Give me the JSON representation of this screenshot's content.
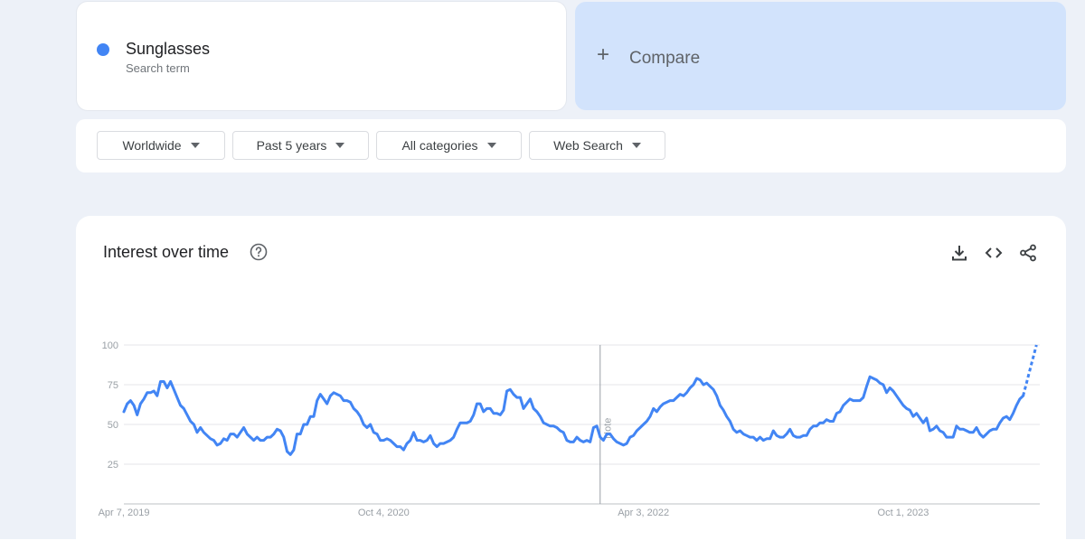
{
  "search_term": {
    "name": "Sunglasses",
    "subtitle": "Search term",
    "color": "#4285f4"
  },
  "compare": {
    "label": "Compare",
    "background": "#d2e3fc"
  },
  "filters": {
    "region": "Worldwide",
    "time_range": "Past 5 years",
    "category": "All categories",
    "search_type": "Web Search"
  },
  "chart": {
    "title": "Interest over time",
    "help_icon": "help-circle-icon",
    "tools": [
      "download-icon",
      "embed-code-icon",
      "share-icon"
    ],
    "note_label": "Note"
  },
  "chart_data": {
    "type": "line",
    "title": "",
    "xlabel": "",
    "ylabel": "",
    "ylim": [
      0,
      100
    ],
    "yticks": [
      25,
      50,
      75,
      100
    ],
    "xtick_labels": [
      "Apr 7, 2019",
      "Oct 4, 2020",
      "Apr 3, 2022",
      "Oct 1, 2023"
    ],
    "grid": true,
    "series": [
      {
        "name": "Sunglasses",
        "color": "#4285f4",
        "values": [
          58,
          63,
          65,
          62,
          56,
          63,
          66,
          70,
          70,
          71,
          68,
          77,
          77,
          73,
          77,
          72,
          67,
          62,
          60,
          56,
          52,
          50,
          45,
          48,
          45,
          43,
          41,
          40,
          37,
          38,
          41,
          40,
          44,
          44,
          42,
          45,
          48,
          44,
          42,
          40,
          42,
          40,
          40,
          42,
          42,
          44,
          47,
          46,
          42,
          33,
          31,
          34,
          44,
          44,
          50,
          50,
          55,
          55,
          65,
          69,
          66,
          63,
          68,
          70,
          69,
          68,
          65,
          65,
          64,
          60,
          58,
          55,
          50,
          48,
          50,
          45,
          44,
          40,
          40,
          41,
          40,
          38,
          36,
          36,
          34,
          38,
          40,
          45,
          40,
          40,
          39,
          40,
          43,
          38,
          36,
          38,
          38,
          39,
          40,
          42,
          47,
          51,
          51,
          51,
          52,
          56,
          63,
          63,
          58,
          60,
          60,
          57,
          57,
          56,
          59,
          71,
          72,
          69,
          67,
          67,
          60,
          63,
          66,
          60,
          58,
          55,
          51,
          50,
          49,
          49,
          48,
          46,
          45,
          40,
          39,
          39,
          42,
          40,
          39,
          40,
          39,
          48,
          49,
          42,
          40,
          44,
          44,
          41,
          39,
          38,
          37,
          38,
          42,
          43,
          46,
          48,
          50,
          52,
          55,
          60,
          58,
          61,
          63,
          64,
          65,
          65,
          67,
          69,
          68,
          70,
          73,
          75,
          79,
          78,
          75,
          76,
          74,
          72,
          68,
          62,
          59,
          55,
          52,
          47,
          45,
          46,
          44,
          43,
          42,
          42,
          40,
          42,
          40,
          41,
          41,
          46,
          43,
          42,
          42,
          44,
          47,
          43,
          42,
          42,
          43,
          43,
          47,
          49,
          49,
          51,
          51,
          53,
          52,
          52,
          57,
          58,
          62,
          64,
          66,
          65,
          65,
          65,
          67,
          74,
          80,
          79,
          78,
          76,
          75,
          70,
          73,
          71,
          68,
          65,
          62,
          60,
          59,
          55,
          57,
          54,
          51,
          54,
          46,
          47,
          49,
          46,
          45,
          42,
          42,
          42,
          49,
          47,
          47,
          46,
          45,
          45,
          48,
          44,
          42,
          44,
          46,
          47,
          47,
          51,
          54,
          55,
          53,
          57,
          62,
          66,
          68
        ],
        "partial_values": [
          68,
          76,
          84,
          92,
          100
        ]
      }
    ]
  }
}
